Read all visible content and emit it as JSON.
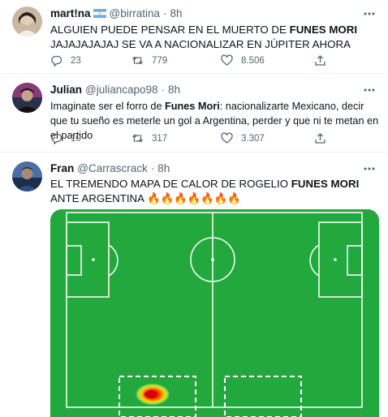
{
  "tweets": [
    {
      "name": "mart!na",
      "flag_icon": "argentina-flag-icon",
      "handle": "@birratina",
      "dot": "·",
      "time": "8h",
      "text_before": "ALGUIEN PUEDE PENSAR EN EL MUERTO DE ",
      "text_bold": "FUNES MORI",
      "text_after": " JAJAJAJAJAJ SE VA A NACIONALIZAR EN JÚPITER AHORA",
      "replies": "23",
      "retweets": "779",
      "likes": "8.506"
    },
    {
      "name": "Julian",
      "handle": "@juliancapo98",
      "dot": "·",
      "time": "8h",
      "text_before": "Imaginate ser el forro de ",
      "text_bold": "Funes Mori",
      "text_after": ": nacionalizarte Mexicano, decir que tu sueño es meterle un gol a Argentina, perder y que ni te metan en el partido",
      "replies": "10",
      "retweets": "317",
      "likes": "3.307"
    },
    {
      "name": "Fran",
      "handle": "@Carrascrack",
      "dot": "·",
      "time": "8h",
      "text_before": "EL TREMENDO MAPA DE CALOR DE ROGELIO ",
      "text_bold": "FUNES MORI",
      "text_after": " ANTE ARGENTINA 🔥🔥🔥🔥🔥🔥🔥",
      "media_icon": "football-pitch-heatmap"
    }
  ],
  "colors": {
    "text": "#0f1419",
    "secondary": "#536471",
    "pitch": "#22a83c",
    "divider": "#eff3f4"
  },
  "icons": [
    "reply-icon",
    "retweet-icon",
    "like-icon",
    "share-icon",
    "more-icon"
  ]
}
